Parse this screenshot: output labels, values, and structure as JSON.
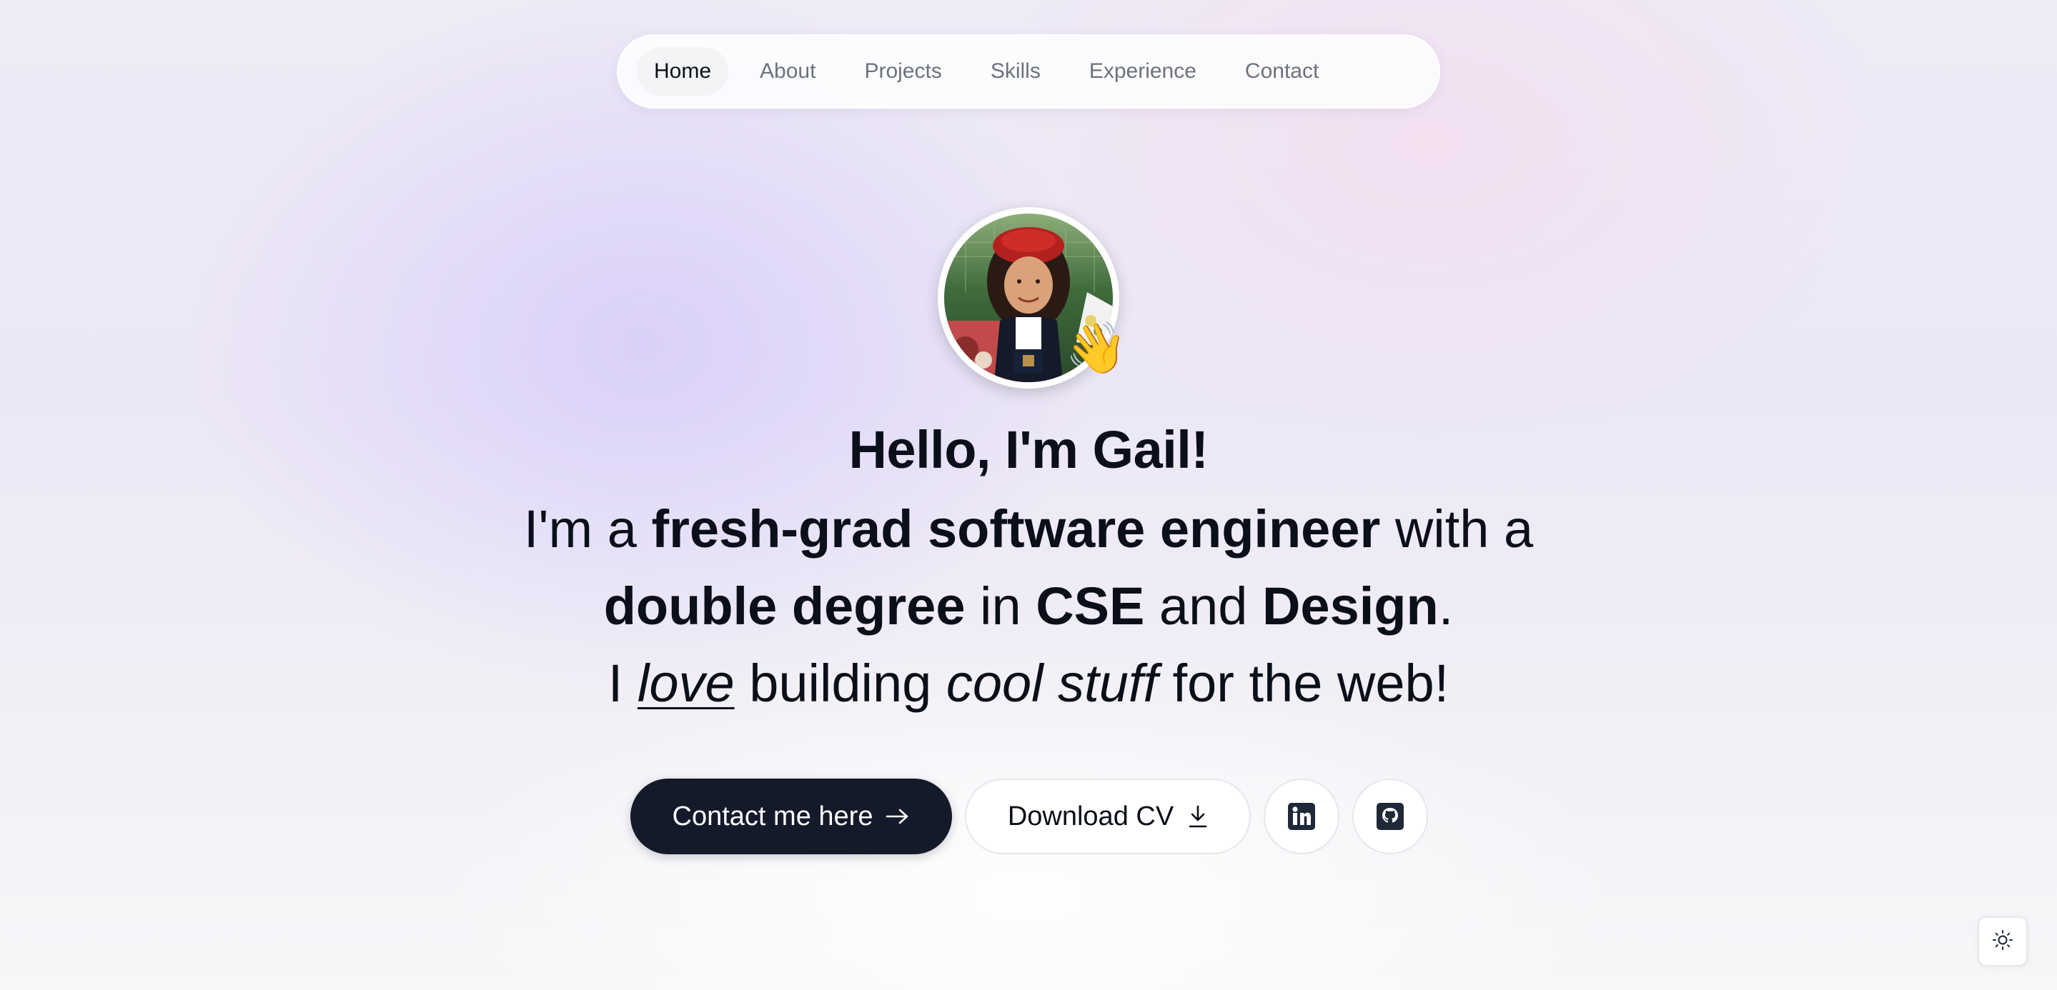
{
  "nav": {
    "items": [
      {
        "label": "Home",
        "active": true
      },
      {
        "label": "About",
        "active": false
      },
      {
        "label": "Projects",
        "active": false
      },
      {
        "label": "Skills",
        "active": false
      },
      {
        "label": "Experience",
        "active": false
      },
      {
        "label": "Contact",
        "active": false
      }
    ]
  },
  "hero": {
    "avatar_alt": "avatar",
    "wave_emoji": "👋",
    "greeting": "Hello, I'm Gail!",
    "line1": {
      "pre": "I'm a ",
      "bold": "fresh-grad software engineer",
      "post": " with a"
    },
    "line2": {
      "bold1": "double degree",
      "mid1": " in ",
      "bold2": "CSE",
      "mid2": " and ",
      "bold3": "Design",
      "post": "."
    },
    "line3": {
      "pre": "I ",
      "love": "love",
      "mid": " building ",
      "italic": "cool stuff",
      "post": " for the web!"
    }
  },
  "actions": {
    "contact_label": "Contact me here",
    "contact_icon": "arrow-right-icon",
    "cv_label": "Download CV",
    "cv_icon": "download-icon",
    "linkedin_icon": "linkedin-icon",
    "github_icon": "github-icon"
  },
  "theme_toggle": {
    "icon": "sun-icon"
  },
  "colors": {
    "primary_button": "#141a2a",
    "text": "#0b0f1a",
    "nav_muted": "#6b7280"
  }
}
